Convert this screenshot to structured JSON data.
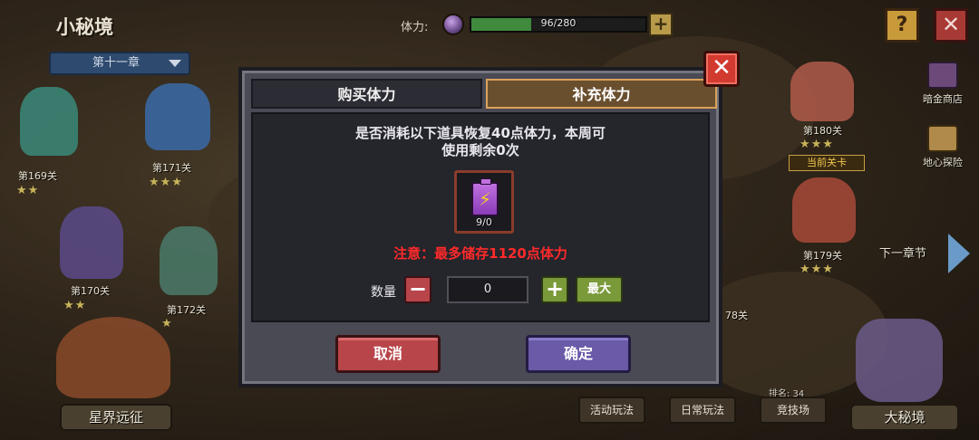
{
  "hud": {
    "title": "小秘境",
    "chapter": "第十一章",
    "stamina_label": "体力:",
    "stamina_text": "96/280",
    "stamina_current": 96,
    "stamina_max": 280,
    "help_label": "?",
    "close_label": "✕",
    "plus_label": "+"
  },
  "side_icons": [
    {
      "label": "暗金商店"
    },
    {
      "label": "地心探险"
    }
  ],
  "stages": {
    "s169": "第169关",
    "s171": "第171关",
    "s170": "第170关",
    "s172": "第172关",
    "s180": "第180关",
    "s179": "第179关",
    "s178": "78关",
    "current": "当前关卡",
    "next_chapter": "下一章节"
  },
  "bottom": {
    "left_big": "星界远征",
    "activity": "活动玩法",
    "daily": "日常玩法",
    "arena": "竞技场",
    "rank": "排名: 34",
    "right_big": "大秘境"
  },
  "modal": {
    "tab_buy": "购买体力",
    "tab_refill": "补充体力",
    "message_line1": "是否消耗以下道具恢复40点体力，本周可",
    "message_line2": "使用剩余0次",
    "item_icon": "purple-battery-bolt-icon",
    "item_count": "9/0",
    "warning": "注意：最多储存1120点体力",
    "qty_label": "数量",
    "minus": "−",
    "qty_value": "0",
    "plus": "+",
    "max": "最大",
    "cancel": "取消",
    "confirm": "确定",
    "close": "✕"
  },
  "colors": {
    "warning": "#ff2a2a",
    "cancel": "#b8454a",
    "confirm": "#6a5aa8",
    "active_tab_border": "#d9a25a",
    "plus_green": "#7a9a3a"
  }
}
